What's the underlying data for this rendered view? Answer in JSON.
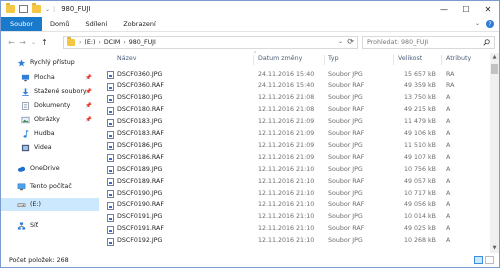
{
  "window": {
    "title": "980_FUJI",
    "controls": {
      "minimize": "—",
      "maximize": "☐",
      "close": "✕"
    }
  },
  "ribbon": {
    "tabs": [
      "Soubor",
      "Domů",
      "Sdílení",
      "Zobrazení"
    ],
    "expand_glyph": "⌄",
    "help_glyph": "?"
  },
  "nav": {
    "back": "←",
    "forward": "→",
    "recent": "⌄",
    "up": "↑",
    "breadcrumb": [
      "(E:)",
      "DCIM",
      "980_FUJI"
    ],
    "crumb_separator": "›",
    "dropdown": "⌄",
    "refresh": "⟳",
    "search_placeholder": "Prohledat: 980_FUJI"
  },
  "sidebar": {
    "items": [
      {
        "label": "Rychlý přístup",
        "icon": "star-icon",
        "pinned": false
      },
      {
        "label": "Plocha",
        "icon": "desktop-icon",
        "pinned": true
      },
      {
        "label": "Stažené soubory",
        "icon": "download-icon",
        "pinned": true
      },
      {
        "label": "Dokumenty",
        "icon": "documents-icon",
        "pinned": true
      },
      {
        "label": "Obrázky",
        "icon": "pictures-icon",
        "pinned": true
      },
      {
        "label": "Hudba",
        "icon": "music-icon",
        "pinned": false
      },
      {
        "label": "Videa",
        "icon": "videos-icon",
        "pinned": false
      },
      {
        "label": "OneDrive",
        "icon": "cloud-icon",
        "pinned": false
      },
      {
        "label": "Tento počítač",
        "icon": "computer-icon",
        "pinned": false
      },
      {
        "label": "(E:)",
        "icon": "drive-icon",
        "pinned": false,
        "selected": true
      },
      {
        "label": "Síť",
        "icon": "network-icon",
        "pinned": false
      }
    ],
    "pin_glyph": "📌"
  },
  "columns": {
    "name": "Název",
    "date": "Datum změny",
    "type": "Typ",
    "size": "Velikost",
    "attributes": "Atributy",
    "sort_glyph": "⌃"
  },
  "files": [
    {
      "name": "DSCF0360.JPG",
      "date": "24.11.2016 15:40",
      "type": "Soubor JPG",
      "size": "15 657 kB",
      "attr": "RA"
    },
    {
      "name": "DSCF0360.RAF",
      "date": "24.11.2016 15:40",
      "type": "Soubor RAF",
      "size": "49 359 kB",
      "attr": "RA"
    },
    {
      "name": "DSCF0180.JPG",
      "date": "12.11.2016 21:08",
      "type": "Soubor JPG",
      "size": "13 750 kB",
      "attr": "A"
    },
    {
      "name": "DSCF0180.RAF",
      "date": "12.11.2016 21:08",
      "type": "Soubor RAF",
      "size": "49 215 kB",
      "attr": "A"
    },
    {
      "name": "DSCF0183.JPG",
      "date": "12.11.2016 21:09",
      "type": "Soubor JPG",
      "size": "11 479 kB",
      "attr": "A"
    },
    {
      "name": "DSCF0183.RAF",
      "date": "12.11.2016 21:09",
      "type": "Soubor RAF",
      "size": "49 106 kB",
      "attr": "A"
    },
    {
      "name": "DSCF0186.JPG",
      "date": "12.11.2016 21:09",
      "type": "Soubor JPG",
      "size": "11 510 kB",
      "attr": "A"
    },
    {
      "name": "DSCF0186.RAF",
      "date": "12.11.2016 21:09",
      "type": "Soubor RAF",
      "size": "49 107 kB",
      "attr": "A"
    },
    {
      "name": "DSCF0189.JPG",
      "date": "12.11.2016 21:10",
      "type": "Soubor JPG",
      "size": "10 756 kB",
      "attr": "A"
    },
    {
      "name": "DSCF0189.RAF",
      "date": "12.11.2016 21:10",
      "type": "Soubor RAF",
      "size": "49 057 kB",
      "attr": "A"
    },
    {
      "name": "DSCF0190.JPG",
      "date": "12.11.2016 21:10",
      "type": "Soubor JPG",
      "size": "10 717 kB",
      "attr": "A"
    },
    {
      "name": "DSCF0190.RAF",
      "date": "12.11.2016 21:10",
      "type": "Soubor RAF",
      "size": "49 056 kB",
      "attr": "A"
    },
    {
      "name": "DSCF0191.JPG",
      "date": "12.11.2016 21:10",
      "type": "Soubor JPG",
      "size": "10 014 kB",
      "attr": "A"
    },
    {
      "name": "DSCF0191.RAF",
      "date": "12.11.2016 21:10",
      "type": "Soubor RAF",
      "size": "49 025 kB",
      "attr": "A"
    },
    {
      "name": "DSCF0192.JPG",
      "date": "12.11.2016 21:10",
      "type": "Soubor JPG",
      "size": "10 268 kB",
      "attr": "A"
    }
  ],
  "scrollbar": {
    "up": "▲",
    "down": "▼"
  },
  "status": {
    "item_count": "Počet položek: 268"
  },
  "colors": {
    "accent": "#1979ca",
    "selected_bg": "#cce8ff",
    "header_text": "#4c5e79",
    "folder": "#f3c644"
  }
}
